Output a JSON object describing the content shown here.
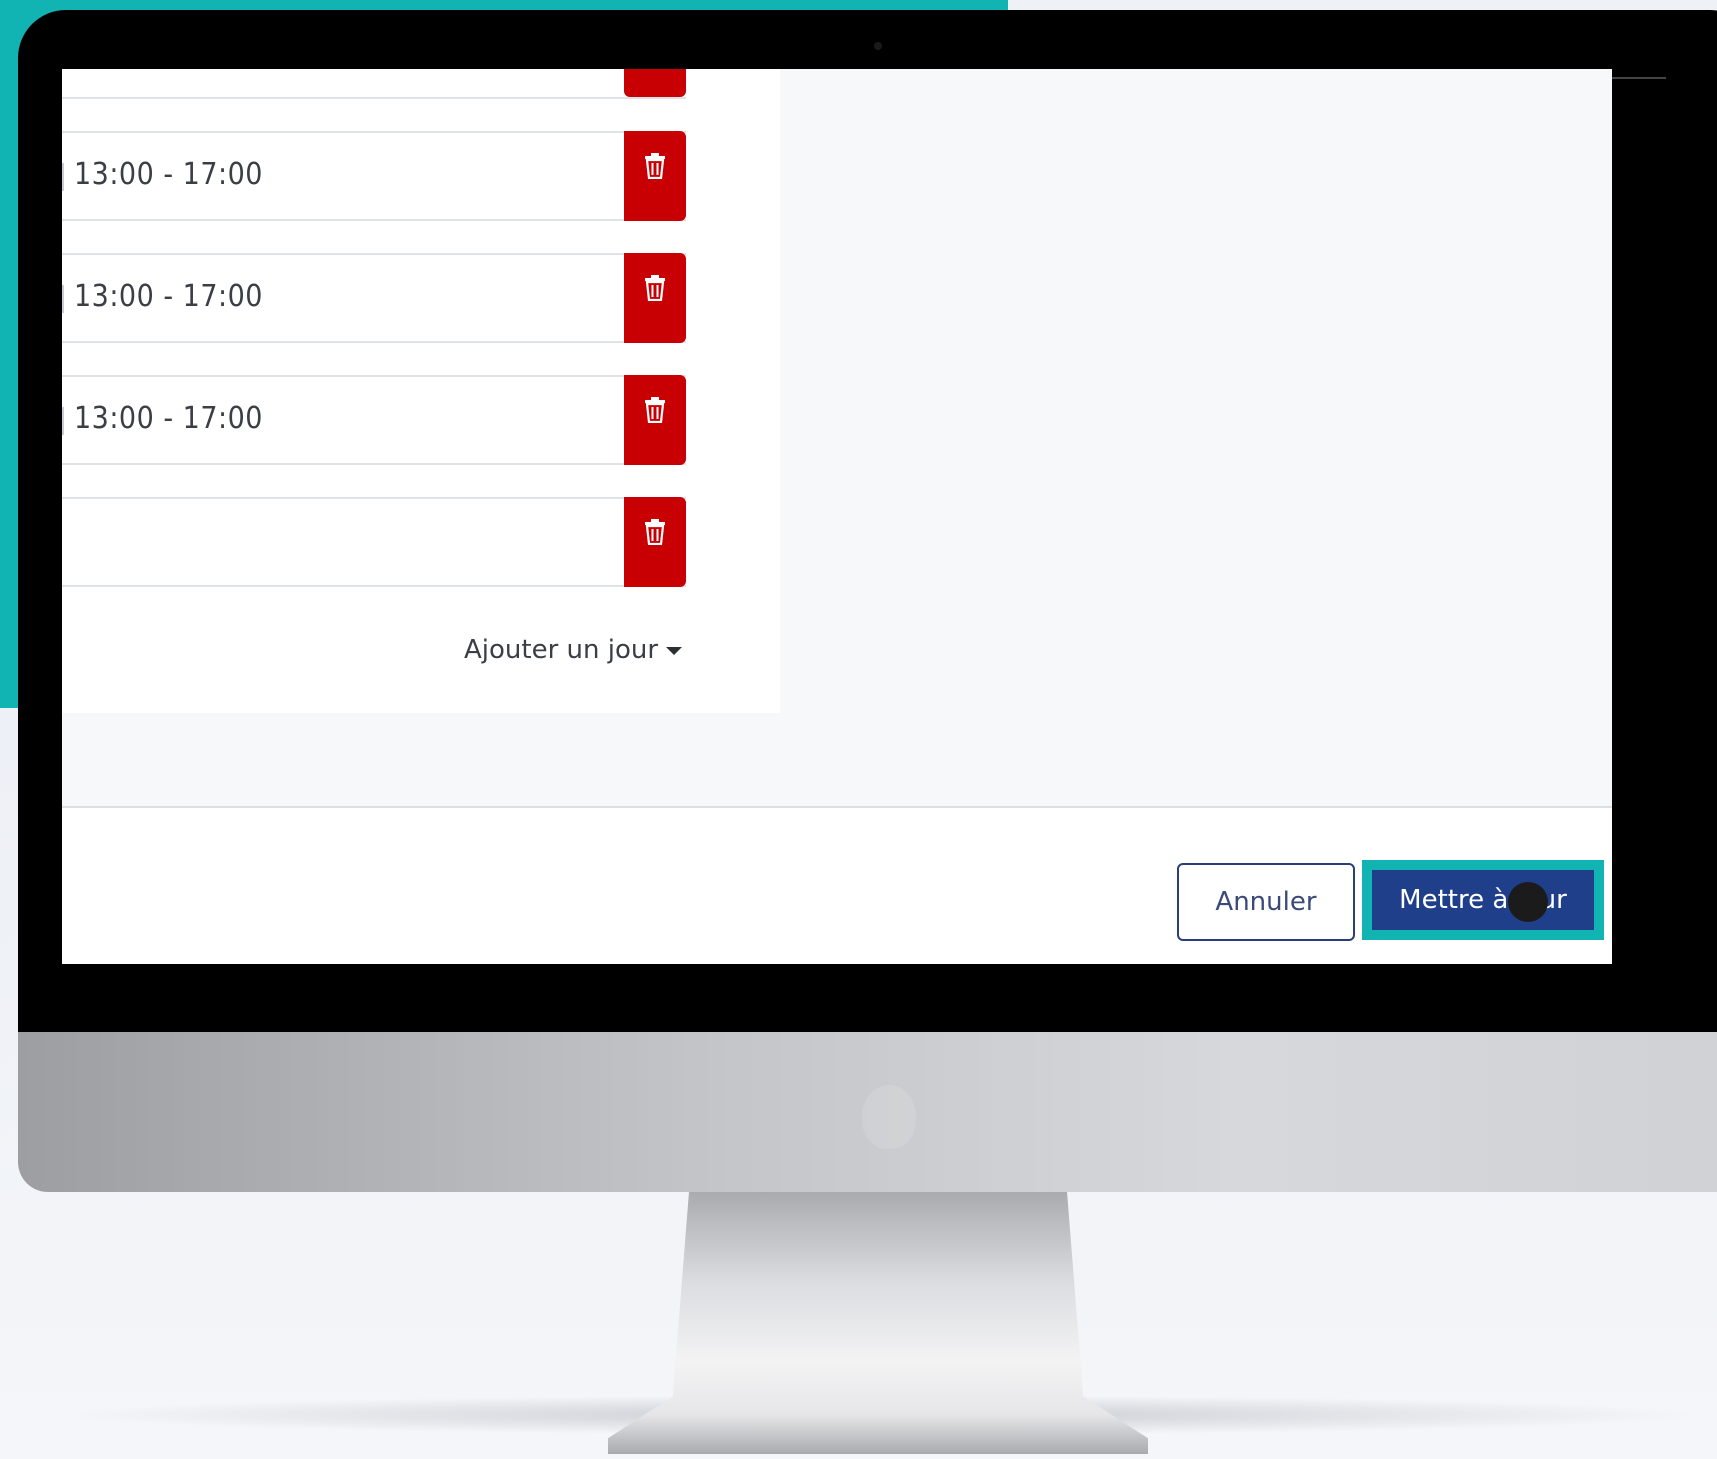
{
  "schedule": {
    "rows": [
      {
        "time": ""
      },
      {
        "time": "13:00 - 17:00"
      },
      {
        "time": "13:00 - 17:00"
      },
      {
        "time": "13:00 - 17:00"
      },
      {
        "time": ""
      }
    ],
    "add_day_label": "Ajouter un jour"
  },
  "footer": {
    "cancel_label": "Annuler",
    "update_label": "Mettre à jour"
  },
  "colors": {
    "accent_teal": "#12b3b3",
    "delete_red": "#c80004",
    "primary_blue": "#1f3f8a"
  },
  "icons": {
    "delete": "trash-icon",
    "dropdown": "caret-down-icon"
  }
}
